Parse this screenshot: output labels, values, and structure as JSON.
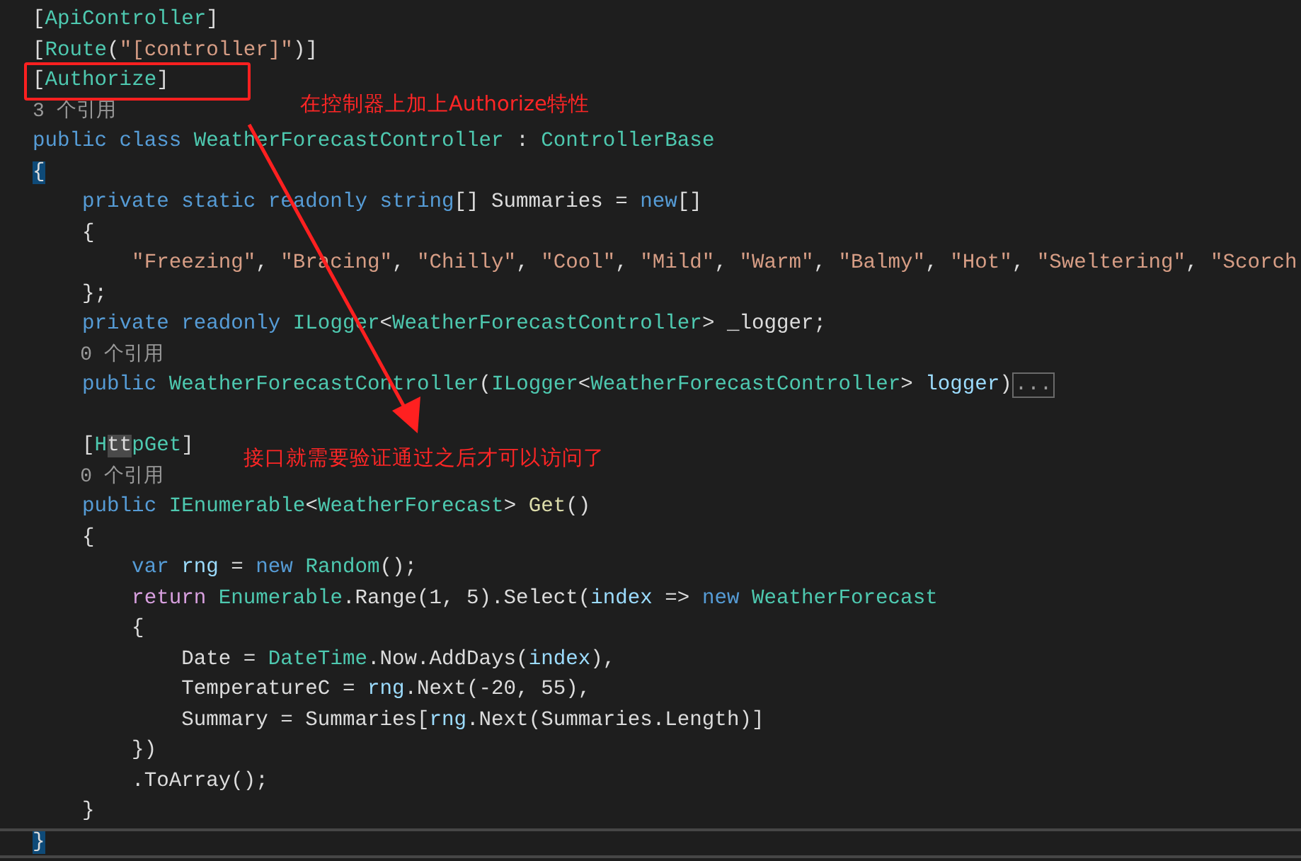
{
  "editor": {
    "lines": [
      {
        "current": false,
        "tokens": [
          {
            "kind": "plain",
            "text": "["
          },
          {
            "kind": "type",
            "text": "ApiController"
          },
          {
            "kind": "plain",
            "text": "]"
          }
        ]
      },
      {
        "current": false,
        "tokens": [
          {
            "kind": "plain",
            "text": "["
          },
          {
            "kind": "type",
            "text": "Route"
          },
          {
            "kind": "plain",
            "text": "("
          },
          {
            "kind": "string",
            "text": "\"[controller]\""
          },
          {
            "kind": "plain",
            "text": ")]"
          }
        ]
      },
      {
        "current": false,
        "tokens": [
          {
            "kind": "plain",
            "text": "["
          },
          {
            "kind": "type",
            "text": "Authorize"
          },
          {
            "kind": "plain",
            "text": "]"
          }
        ]
      },
      {
        "current": false,
        "tokens": [
          {
            "kind": "lens",
            "text": "3 个引用"
          }
        ]
      },
      {
        "current": false,
        "tokens": [
          {
            "kind": "keyword",
            "text": "public class "
          },
          {
            "kind": "type",
            "text": "WeatherForecastController"
          },
          {
            "kind": "plain",
            "text": " : "
          },
          {
            "kind": "type",
            "text": "ControllerBase"
          }
        ]
      },
      {
        "current": false,
        "tokens": [
          {
            "kind": "brace-match",
            "text": "{"
          }
        ]
      },
      {
        "current": false,
        "tokens": [
          {
            "kind": "keyword",
            "text": "    private static readonly string"
          },
          {
            "kind": "plain",
            "text": "[] Summaries = "
          },
          {
            "kind": "keyword",
            "text": "new"
          },
          {
            "kind": "plain",
            "text": "[]"
          }
        ]
      },
      {
        "current": false,
        "tokens": [
          {
            "kind": "plain",
            "text": "    {"
          }
        ]
      },
      {
        "current": false,
        "tokens": [
          {
            "kind": "string",
            "text": "        \"Freezing\""
          },
          {
            "kind": "plain",
            "text": ", "
          },
          {
            "kind": "string",
            "text": "\"Bracing\""
          },
          {
            "kind": "plain",
            "text": ", "
          },
          {
            "kind": "string",
            "text": "\"Chilly\""
          },
          {
            "kind": "plain",
            "text": ", "
          },
          {
            "kind": "string",
            "text": "\"Cool\""
          },
          {
            "kind": "plain",
            "text": ", "
          },
          {
            "kind": "string",
            "text": "\"Mild\""
          },
          {
            "kind": "plain",
            "text": ", "
          },
          {
            "kind": "string",
            "text": "\"Warm\""
          },
          {
            "kind": "plain",
            "text": ", "
          },
          {
            "kind": "string",
            "text": "\"Balmy\""
          },
          {
            "kind": "plain",
            "text": ", "
          },
          {
            "kind": "string",
            "text": "\"Hot\""
          },
          {
            "kind": "plain",
            "text": ", "
          },
          {
            "kind": "string",
            "text": "\"Sweltering\""
          },
          {
            "kind": "plain",
            "text": ", "
          },
          {
            "kind": "string",
            "text": "\"Scorch"
          }
        ]
      },
      {
        "current": false,
        "tokens": [
          {
            "kind": "plain",
            "text": "    };"
          }
        ]
      },
      {
        "current": false,
        "tokens": [
          {
            "kind": "keyword",
            "text": "    private readonly "
          },
          {
            "kind": "type",
            "text": "ILogger"
          },
          {
            "kind": "plain",
            "text": "<"
          },
          {
            "kind": "type",
            "text": "WeatherForecastController"
          },
          {
            "kind": "plain",
            "text": "> _logger;"
          }
        ]
      },
      {
        "current": false,
        "tokens": [
          {
            "kind": "lens",
            "text": "    0 个引用"
          }
        ]
      },
      {
        "current": false,
        "tokens": [
          {
            "kind": "keyword",
            "text": "    public "
          },
          {
            "kind": "type",
            "text": "WeatherForecastController"
          },
          {
            "kind": "plain",
            "text": "("
          },
          {
            "kind": "type",
            "text": "ILogger"
          },
          {
            "kind": "plain",
            "text": "<"
          },
          {
            "kind": "type",
            "text": "WeatherForecastController"
          },
          {
            "kind": "plain",
            "text": "> "
          },
          {
            "kind": "param",
            "text": "logger"
          },
          {
            "kind": "plain",
            "text": ")"
          },
          {
            "kind": "fold",
            "text": "..."
          }
        ]
      },
      {
        "current": false,
        "blank_before": true,
        "tokens": [
          {
            "kind": "plain",
            "text": "    ["
          },
          {
            "kind": "type",
            "text": "H"
          },
          {
            "kind": "highlight",
            "text": "tt"
          },
          {
            "kind": "type",
            "text": "pGet"
          },
          {
            "kind": "plain",
            "text": "]"
          }
        ]
      },
      {
        "current": false,
        "tokens": [
          {
            "kind": "lens",
            "text": "    0 个引用"
          }
        ]
      },
      {
        "current": false,
        "tokens": [
          {
            "kind": "keyword",
            "text": "    public "
          },
          {
            "kind": "type",
            "text": "IEnumerable"
          },
          {
            "kind": "plain",
            "text": "<"
          },
          {
            "kind": "type",
            "text": "WeatherForecast"
          },
          {
            "kind": "plain",
            "text": "> "
          },
          {
            "kind": "method",
            "text": "Get"
          },
          {
            "kind": "plain",
            "text": "()"
          }
        ]
      },
      {
        "current": false,
        "tokens": [
          {
            "kind": "plain",
            "text": "    {"
          }
        ]
      },
      {
        "current": false,
        "tokens": [
          {
            "kind": "keyword",
            "text": "        var "
          },
          {
            "kind": "param",
            "text": "rng"
          },
          {
            "kind": "plain",
            "text": " = "
          },
          {
            "kind": "keyword",
            "text": "new "
          },
          {
            "kind": "type",
            "text": "Random"
          },
          {
            "kind": "plain",
            "text": "();"
          }
        ]
      },
      {
        "current": false,
        "tokens": [
          {
            "kind": "control",
            "text": "        return "
          },
          {
            "kind": "type",
            "text": "Enumerable"
          },
          {
            "kind": "plain",
            "text": ".Range(1, 5).Select("
          },
          {
            "kind": "param",
            "text": "index"
          },
          {
            "kind": "plain",
            "text": " => "
          },
          {
            "kind": "keyword",
            "text": "new "
          },
          {
            "kind": "type",
            "text": "WeatherForecast"
          }
        ]
      },
      {
        "current": false,
        "tokens": [
          {
            "kind": "plain",
            "text": "        {"
          }
        ]
      },
      {
        "current": false,
        "tokens": [
          {
            "kind": "plain",
            "text": "            Date = "
          },
          {
            "kind": "type",
            "text": "DateTime"
          },
          {
            "kind": "plain",
            "text": ".Now.AddDays("
          },
          {
            "kind": "param",
            "text": "index"
          },
          {
            "kind": "plain",
            "text": "),"
          }
        ]
      },
      {
        "current": false,
        "tokens": [
          {
            "kind": "plain",
            "text": "            TemperatureC = "
          },
          {
            "kind": "param",
            "text": "rng"
          },
          {
            "kind": "plain",
            "text": ".Next(-20, 55),"
          }
        ]
      },
      {
        "current": false,
        "tokens": [
          {
            "kind": "plain",
            "text": "            Summary = Summaries["
          },
          {
            "kind": "param",
            "text": "rng"
          },
          {
            "kind": "plain",
            "text": ".Next(Summaries.Length)]"
          }
        ]
      },
      {
        "current": false,
        "tokens": [
          {
            "kind": "plain",
            "text": "        })"
          }
        ]
      },
      {
        "current": false,
        "tokens": [
          {
            "kind": "plain",
            "text": "        .ToArray();"
          }
        ]
      },
      {
        "current": false,
        "tokens": [
          {
            "kind": "plain",
            "text": "    }"
          }
        ]
      },
      {
        "current": true,
        "tokens": [
          {
            "kind": "brace-match",
            "text": "}"
          }
        ]
      }
    ]
  },
  "annotations": [
    {
      "text": "在控制器上加上Authorize特性"
    },
    {
      "text": "接口就需要验证通过之后才可以访问了"
    }
  ]
}
